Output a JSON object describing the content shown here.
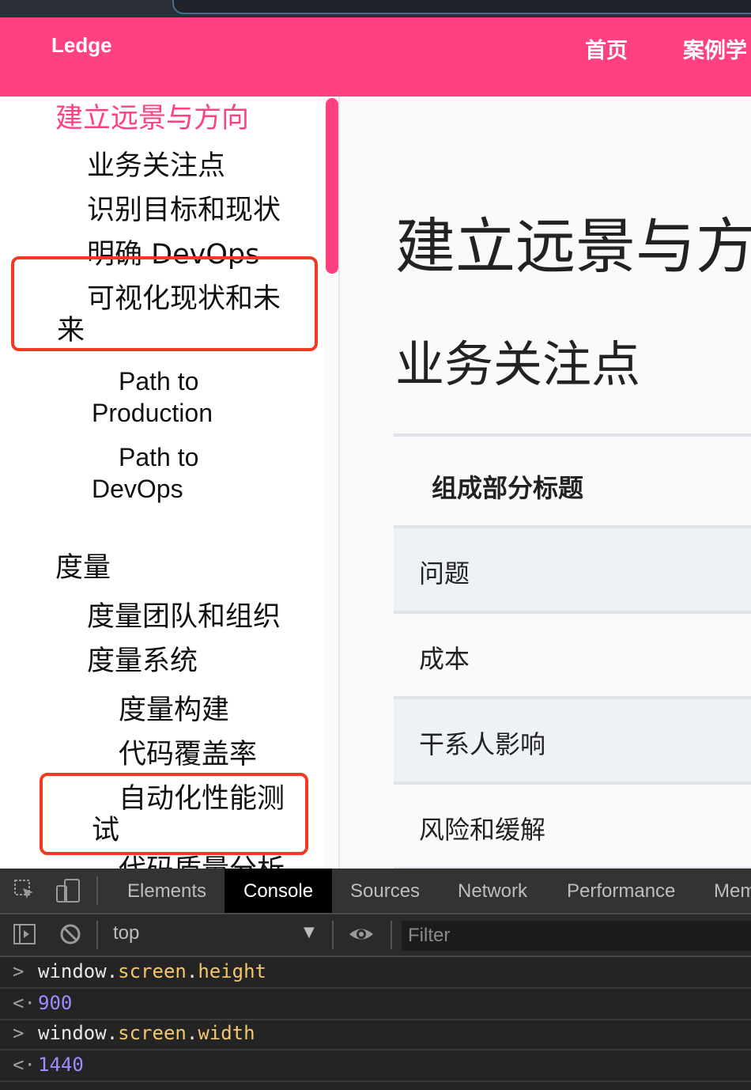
{
  "header": {
    "brand": "Ledge",
    "nav": [
      "首页",
      "案例学"
    ]
  },
  "sidebar": {
    "items": [
      "建立远景与方向",
      "业务关注点",
      "识别目标和现状",
      "明确 DevOps",
      "可视化现状和未",
      "来",
      "Path to",
      "Production",
      "Path to",
      "DevOps",
      "度量",
      "度量团队和组织",
      "度量系统",
      "度量构建",
      "代码覆盖率",
      "自动化性能测",
      "试",
      "代码质量分析"
    ]
  },
  "content": {
    "h1": "建立远景与方向",
    "h2": "业务关注点",
    "table": {
      "header": "组成部分标题",
      "rows": [
        "问题",
        "成本",
        "干系人影响",
        "风险和缓解"
      ]
    }
  },
  "devtools": {
    "tabs": [
      "Elements",
      "Console",
      "Sources",
      "Network",
      "Performance",
      "Mem"
    ],
    "context": "top",
    "filter_placeholder": "Filter",
    "console": {
      "l1_obj": "window",
      "l1_dot1": ".",
      "l1_prop1": "screen",
      "l1_dot2": ".",
      "l1_prop2": "height",
      "r1": "900",
      "l2_obj": "window",
      "l2_dot1": ".",
      "l2_prop1": "screen",
      "l2_dot2": ".",
      "l2_prop2": "width",
      "r2": "1440"
    }
  },
  "colors": {
    "brand": "#ff4081",
    "highlight_box": "#f23a22"
  }
}
